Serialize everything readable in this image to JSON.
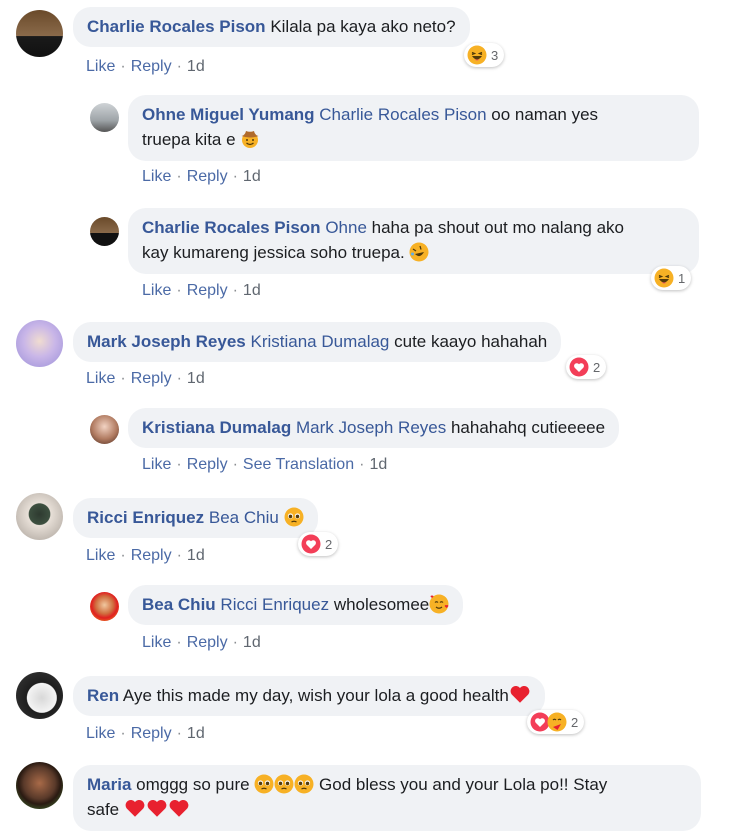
{
  "comments": [
    {
      "author": "Charlie Rocales Pison",
      "text": "Kilala pa kaya ako neto?",
      "like": "Like",
      "reply": "Reply",
      "time": "1d",
      "reaction_count": "3"
    },
    {
      "author": "Ohne Miguel Yumang",
      "mention": "Charlie Rocales Pison",
      "text1": "oo naman yes",
      "text2": "truepa kita e",
      "like": "Like",
      "reply": "Reply",
      "time": "1d"
    },
    {
      "author": "Charlie Rocales Pison",
      "mention": "Ohne",
      "text1": "haha pa shout out mo nalang ako",
      "text2": "kay kumareng jessica soho truepa.",
      "like": "Like",
      "reply": "Reply",
      "time": "1d",
      "reaction_count": "1"
    },
    {
      "author": "Mark Joseph Reyes",
      "mention": "Kristiana Dumalag",
      "text": "cute kaayo hahahah",
      "like": "Like",
      "reply": "Reply",
      "time": "1d",
      "reaction_count": "2"
    },
    {
      "author": "Kristiana Dumalag",
      "mention": "Mark Joseph Reyes",
      "text": "hahahahq cutieeeee",
      "like": "Like",
      "reply": "Reply",
      "translate": "See Translation",
      "time": "1d"
    },
    {
      "author": "Ricci Enriquez",
      "mention": "Bea Chiu",
      "like": "Like",
      "reply": "Reply",
      "time": "1d",
      "reaction_count": "2"
    },
    {
      "author": "Bea Chiu",
      "mention": "Ricci Enriquez",
      "text": "wholesomee",
      "like": "Like",
      "reply": "Reply",
      "time": "1d"
    },
    {
      "author": "Ren",
      "text": "Aye this made my day, wish your lola a good health",
      "like": "Like",
      "reply": "Reply",
      "time": "1d",
      "reaction_count": "2"
    },
    {
      "author": "Maria",
      "text1": "omggg so pure",
      "text2": "God bless you and your Lola po!! Stay",
      "text3": "safe"
    }
  ],
  "colors": {
    "link": "#385898",
    "bubble": "#f0f2f5",
    "heart": "#f33e58",
    "emoji": "#f7b125"
  }
}
